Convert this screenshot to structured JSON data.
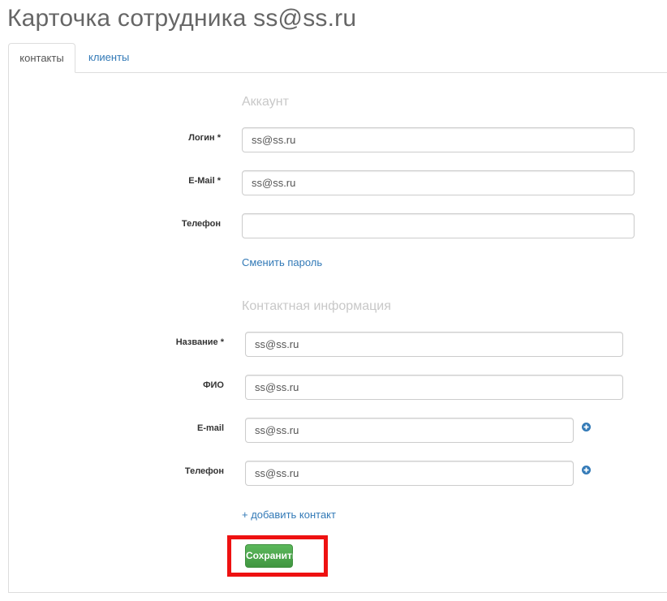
{
  "page": {
    "title": "Карточка сотрудника ss@ss.ru"
  },
  "tabs": [
    {
      "label": "контакты",
      "active": true
    },
    {
      "label": "клиенты",
      "active": false
    }
  ],
  "account": {
    "legend": "Аккаунт",
    "login": {
      "label": "Логин *",
      "value": "ss@ss.ru"
    },
    "email": {
      "label": "E-Mail *",
      "value": "ss@ss.ru"
    },
    "phone": {
      "label": "Телефон",
      "value": ""
    },
    "change_password_link": "Сменить пароль"
  },
  "contact": {
    "legend": "Контактная информация",
    "name": {
      "label": "Название *",
      "value": "ss@ss.ru"
    },
    "fio": {
      "label": "ФИО",
      "value": "ss@ss.ru"
    },
    "email": {
      "label": "E-mail",
      "value": "ss@ss.ru"
    },
    "phone": {
      "label": "Телефон",
      "value": "ss@ss.ru"
    },
    "add_contact_link": "+ добавить контакт"
  },
  "actions": {
    "save_label": "Сохранить"
  },
  "colors": {
    "accent": "#337ab7",
    "save_button": "#4cae4c",
    "highlight": "#ee1111"
  },
  "icons": {
    "add_email": "plus-circle-icon",
    "add_phone": "plus-circle-icon"
  }
}
